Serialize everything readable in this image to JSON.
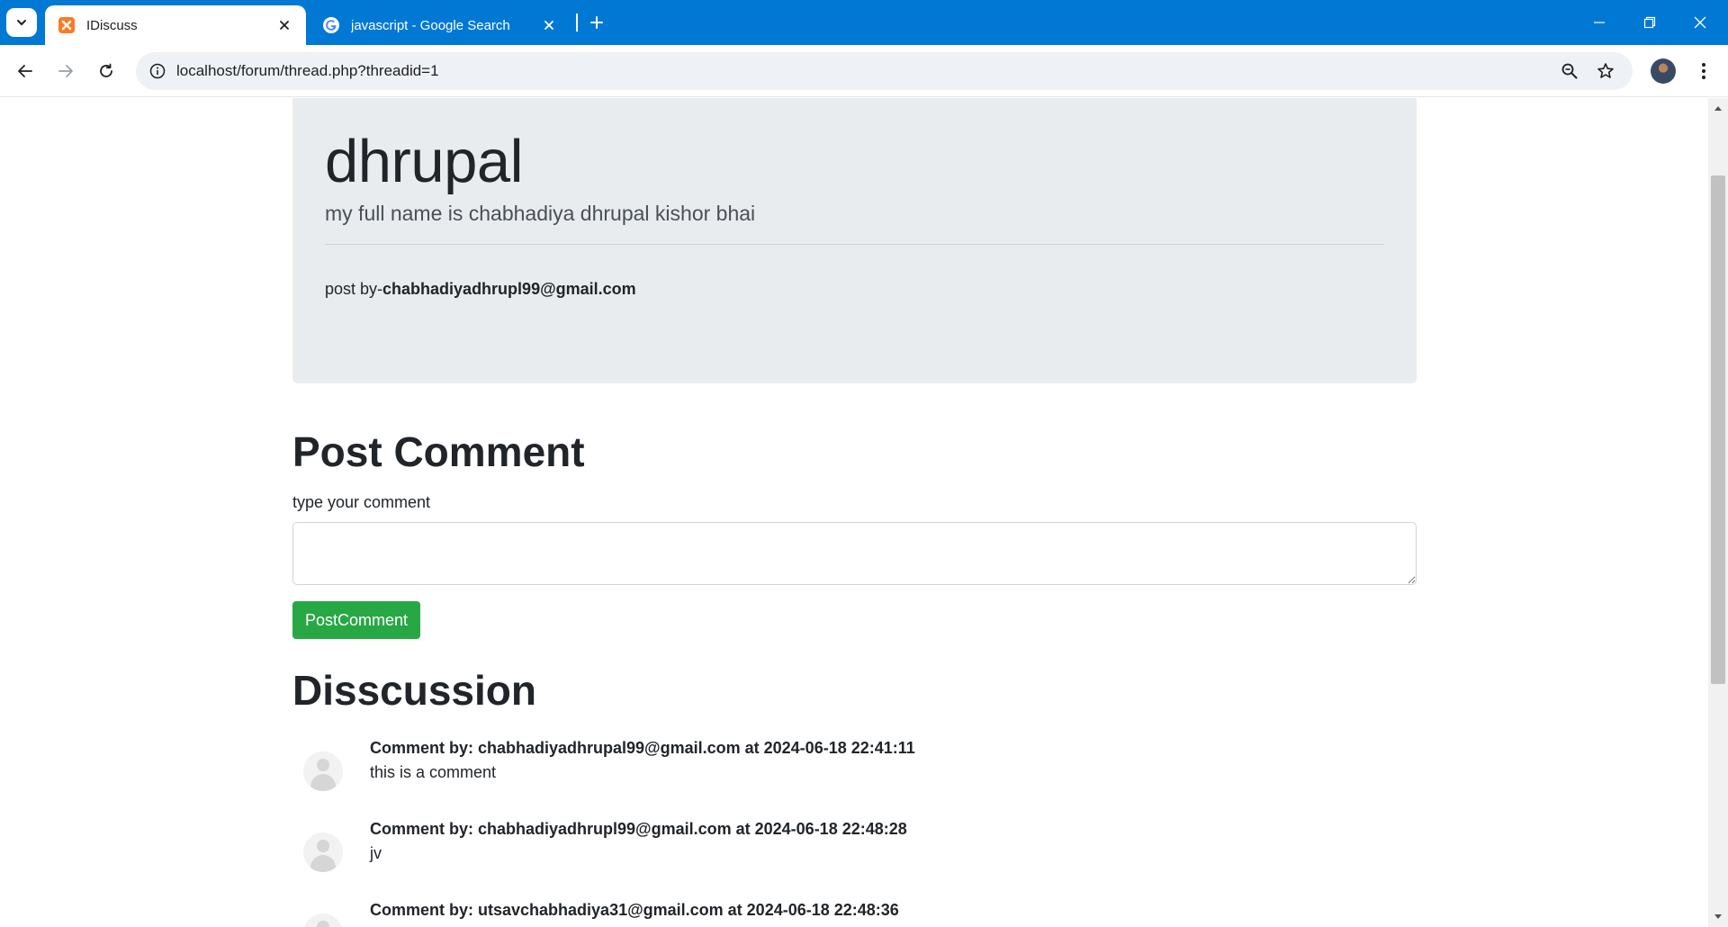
{
  "browser": {
    "tabs": [
      {
        "title": "IDiscuss",
        "active": true,
        "favicon": "xampp-icon"
      },
      {
        "title": "javascript - Google Search",
        "active": false,
        "favicon": "google-icon"
      }
    ],
    "url": "localhost/forum/thread.php?threadid=1"
  },
  "colors": {
    "tabbar": "#0078d4",
    "jumbotron": "#e9ecef",
    "success": "#28a745"
  },
  "thread": {
    "title": "dhrupal",
    "description": "my full name is chabhadiya dhrupal kishor bhai",
    "posted_by_label": "post by-",
    "posted_by_email": "chabhadiyadhrupl99@gmail.com"
  },
  "comment_form": {
    "heading": "Post Comment",
    "label": "type your comment",
    "value": "",
    "submit_label": "PostComment"
  },
  "discussion": {
    "heading": "Disscussion",
    "comments": [
      {
        "header": "Comment by: chabhadiyadhrupal99@gmail.com at 2024-06-18 22:41:11",
        "text": "this is a comment"
      },
      {
        "header": "Comment by: chabhadiyadhrupl99@gmail.com at 2024-06-18 22:48:28",
        "text": "jv"
      },
      {
        "header": "Comment by: utsavchabhadiya31@gmail.com at 2024-06-18 22:48:36",
        "text": ""
      }
    ]
  }
}
